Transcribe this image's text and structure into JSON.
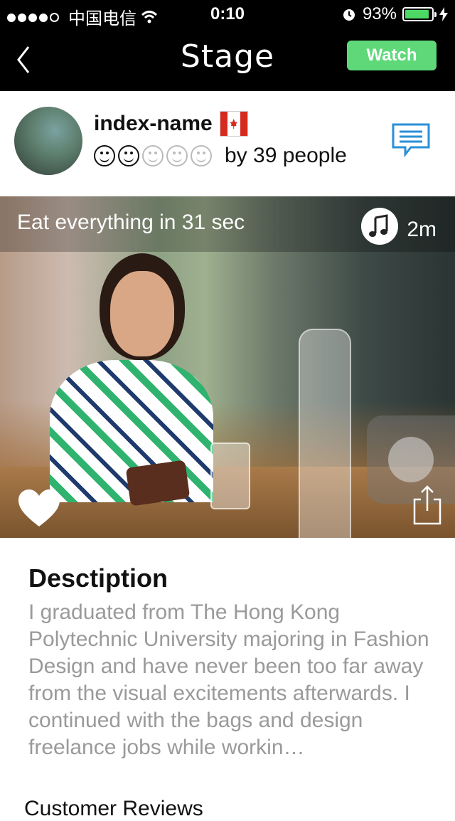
{
  "status_bar": {
    "carrier": "中国电信",
    "time": "0:10",
    "battery_percent": "93%",
    "battery_level": 0.93
  },
  "nav": {
    "title": "Stage",
    "watch_label": "Watch"
  },
  "profile": {
    "username": "index-name",
    "rating": 2,
    "rating_max": 5,
    "rating_text": "by 39 people"
  },
  "media": {
    "caption": "Eat everything in 31 sec",
    "duration": "2m"
  },
  "description": {
    "title": "Desctiption",
    "body": "I graduated from The Hong Kong Polytechnic University majoring in Fashion Design and have never been too far away from the visual excitements afterwards. I continued with the bags and design freelance jobs while workin…"
  },
  "reviews": {
    "title": "Customer Reviews"
  },
  "colors": {
    "watch_button": "#5fd87a",
    "nav_bg": "#000000",
    "comment_icon": "#2a8fd6",
    "battery_fill": "#4cd964"
  },
  "icons": {
    "back": "back-chevron-icon",
    "comment": "comment-icon",
    "music": "music-note-icon",
    "like": "heart-icon",
    "share": "share-icon"
  }
}
